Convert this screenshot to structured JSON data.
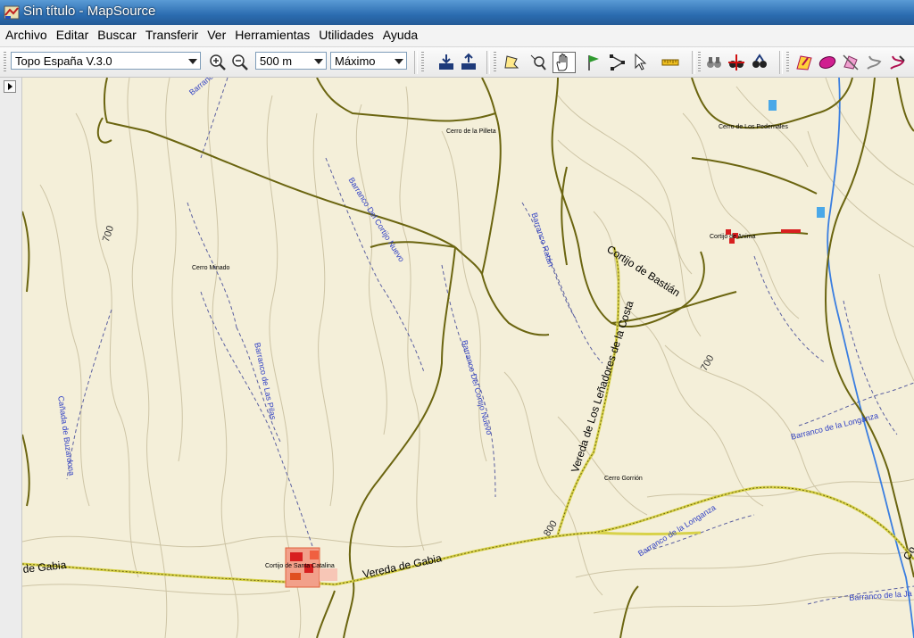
{
  "window": {
    "title": "Sin título - MapSource"
  },
  "menu": {
    "items": [
      "Archivo",
      "Editar",
      "Buscar",
      "Transferir",
      "Ver",
      "Herramientas",
      "Utilidades",
      "Ayuda"
    ]
  },
  "toolbar": {
    "map_product": "Topo España V.3.0",
    "zoom_scale": "500 m",
    "detail_level": "Máximo"
  },
  "map": {
    "peaks": {
      "cerro_pilleta": "Cerro de la Pilleta",
      "cerro_pedernales": "Cerro de Los Pedernales",
      "cerro_minado": "Cerro Minado",
      "cerro_gorrion": "Cerro Gorrión"
    },
    "places": {
      "cortijo_anima": "Cortijo de Anima",
      "cortijo_santa_catalina": "Cortijo de Santa Catalina"
    },
    "streams": {
      "barranco_top": "Barranco de",
      "barranco_cortijo_nuevo_1": "Barranco Del Cortijo Nuevo",
      "barranco_ratan": "Barranco Ratán",
      "barranco_pilas": "Barranco de Las Pilas",
      "canada_buzardona": "Cañada de Buzardona",
      "barranco_cortijo_nuevo_2": "Barranco Del Cortijo Nuevo",
      "barranco_longanza_1": "Barranco de la Longanza",
      "barranco_longanza_2": "Barranco de la Longanza",
      "barranco_bottom": "Barranco de la Ja"
    },
    "roads": {
      "cortijo_bastian": "Cortijo de Bastián",
      "vereda_lenadores": "Vereda de Los Leñadores de la Costa",
      "vereda_gabia": "Vereda de Gabia",
      "gabia_left": "de Gabia",
      "co_right": "Co"
    },
    "elevations": {
      "e700_left": "700",
      "e700_right": "700",
      "e800": "800"
    }
  },
  "colors": {
    "map_bg": "#f4efd9",
    "contour": "#c8bfa0",
    "path": "#6e6a10",
    "road": "#d8d24a",
    "water": "#2f3fc4",
    "river": "#3a7ee0"
  }
}
